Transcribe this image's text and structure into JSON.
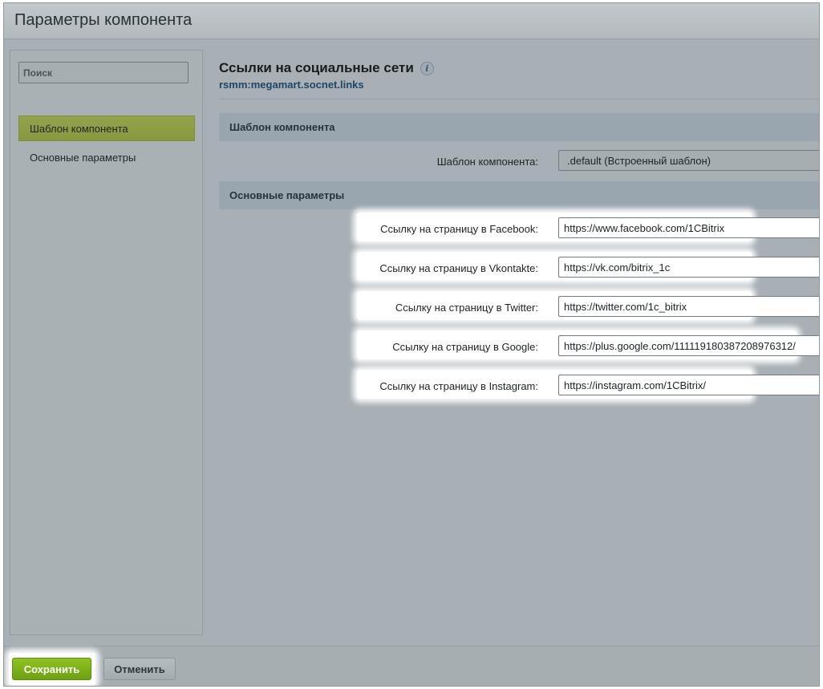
{
  "dialog": {
    "title": "Параметры компонента"
  },
  "sidebar": {
    "search_placeholder": "Поиск",
    "items": [
      {
        "label": "Шаблон компонента",
        "active": true
      },
      {
        "label": "Основные параметры",
        "active": false
      }
    ]
  },
  "component": {
    "title": "Ссылки на социальные сети",
    "info_icon": "i",
    "code": "rsmm:megamart.socnet.links"
  },
  "sections": {
    "template": {
      "title": "Шаблон компонента",
      "field_label": "Шаблон компонента:",
      "field_value": ".default (Встроенный шаблон)"
    },
    "main": {
      "title": "Основные параметры",
      "fields": [
        {
          "label": "Ссылку на страницу в Facebook:",
          "value": "https://www.facebook.com/1CBitrix"
        },
        {
          "label": "Ссылку на страницу в Vkontakte:",
          "value": "https://vk.com/bitrix_1c"
        },
        {
          "label": "Ссылку на страницу в Twitter:",
          "value": "https://twitter.com/1c_bitrix"
        },
        {
          "label": "Ссылку на страницу в Google:",
          "value": "https://plus.google.com/111119180387208976312/"
        },
        {
          "label": "Ссылку на страницу в Instagram:",
          "value": "https://instagram.com/1CBitrix/"
        }
      ]
    }
  },
  "footer": {
    "save_label": "Сохранить",
    "cancel_label": "Отменить"
  },
  "colors": {
    "accent_green": "#7fb31a",
    "active_nav": "#8d9e45"
  }
}
